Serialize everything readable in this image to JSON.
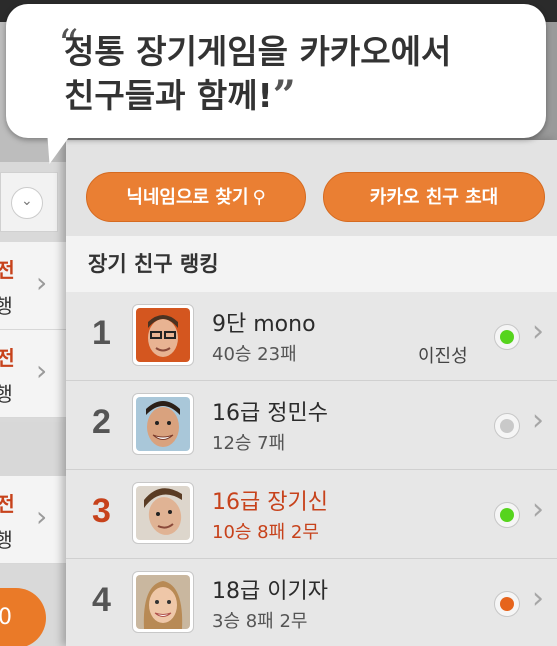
{
  "speech_bubble": {
    "open_quote": "“",
    "line1": "정통 장기게임을 카카오에서",
    "line2": "친구들과 함께!",
    "close_quote": "”"
  },
  "left_panel": {
    "items": [
      {
        "line1": "관전",
        "line2": "진행"
      },
      {
        "line1": "관전",
        "line2": "진행"
      },
      {
        "line1": "관전",
        "line2": "진행"
      }
    ],
    "orange_button_label": "0"
  },
  "buttons": {
    "find_by_nickname": "닉네임으로 찾기",
    "invite_kakao_friends": "카카오 친구 초대"
  },
  "section_title": "장기 친구 랭킹",
  "ranking": [
    {
      "rank": "1",
      "name": "9단 mono",
      "record": "40승 23패",
      "mutual": "이진성",
      "status_color": "#56d41d",
      "highlight": false
    },
    {
      "rank": "2",
      "name": "16급 정민수",
      "record": "12승 7패",
      "mutual": "",
      "status_color": "#c9c9c9",
      "highlight": false
    },
    {
      "rank": "3",
      "name": "16급 장기신",
      "record": "10승 8패 2무",
      "mutual": "",
      "status_color": "#56d41d",
      "highlight": true
    },
    {
      "rank": "4",
      "name": "18급 이기자",
      "record": "3승 8패 2무",
      "mutual": "",
      "status_color": "#e6641c",
      "highlight": false
    }
  ],
  "colors": {
    "accent": "#ea7f33",
    "highlight_text": "#c7421b"
  }
}
